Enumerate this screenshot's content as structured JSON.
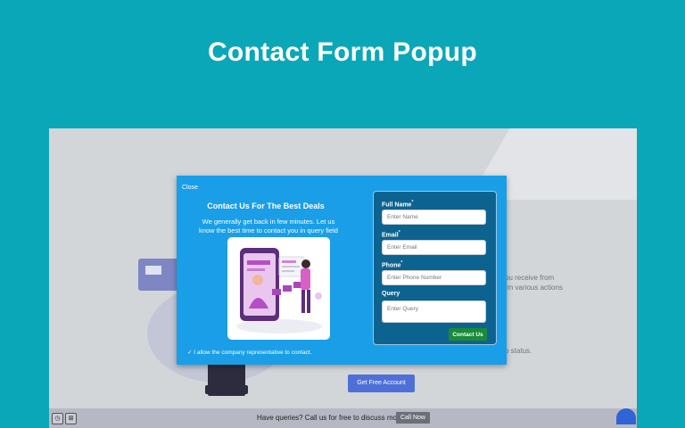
{
  "page": {
    "title": "Contact Form Popup"
  },
  "background_page": {
    "text_fragments": [
      "ou receive from",
      "rm various actions",
      "o status."
    ],
    "cta_button": "Get Free Account",
    "bottom_bar": {
      "message": "Have queries? Call us for free to discuss more.",
      "call_button": "Call Now"
    }
  },
  "popup": {
    "close_label": "Close",
    "heading": "Contact Us For The Best Deals",
    "subheading": "We generally get back in few minutes. Let us know the best time to contact you in query field",
    "consent": "✓ I allow the company representative to contact.",
    "form": {
      "full_name_label": "Full Name",
      "full_name_placeholder": "Enter Name",
      "email_label": "Email",
      "email_placeholder": "Enter Email",
      "phone_label": "Phone",
      "phone_placeholder": "Enter Phone Number",
      "query_label": "Query",
      "query_placeholder": "Enter Query",
      "required_mark": "*",
      "submit_label": "Contact Us"
    }
  },
  "colors": {
    "page_bg": "#0aa7b9",
    "popup_bg": "#1a9ee7",
    "form_bg": "#0d6390",
    "submit_bg": "#1b8a3a",
    "cta_bg": "#4f6fd8"
  }
}
